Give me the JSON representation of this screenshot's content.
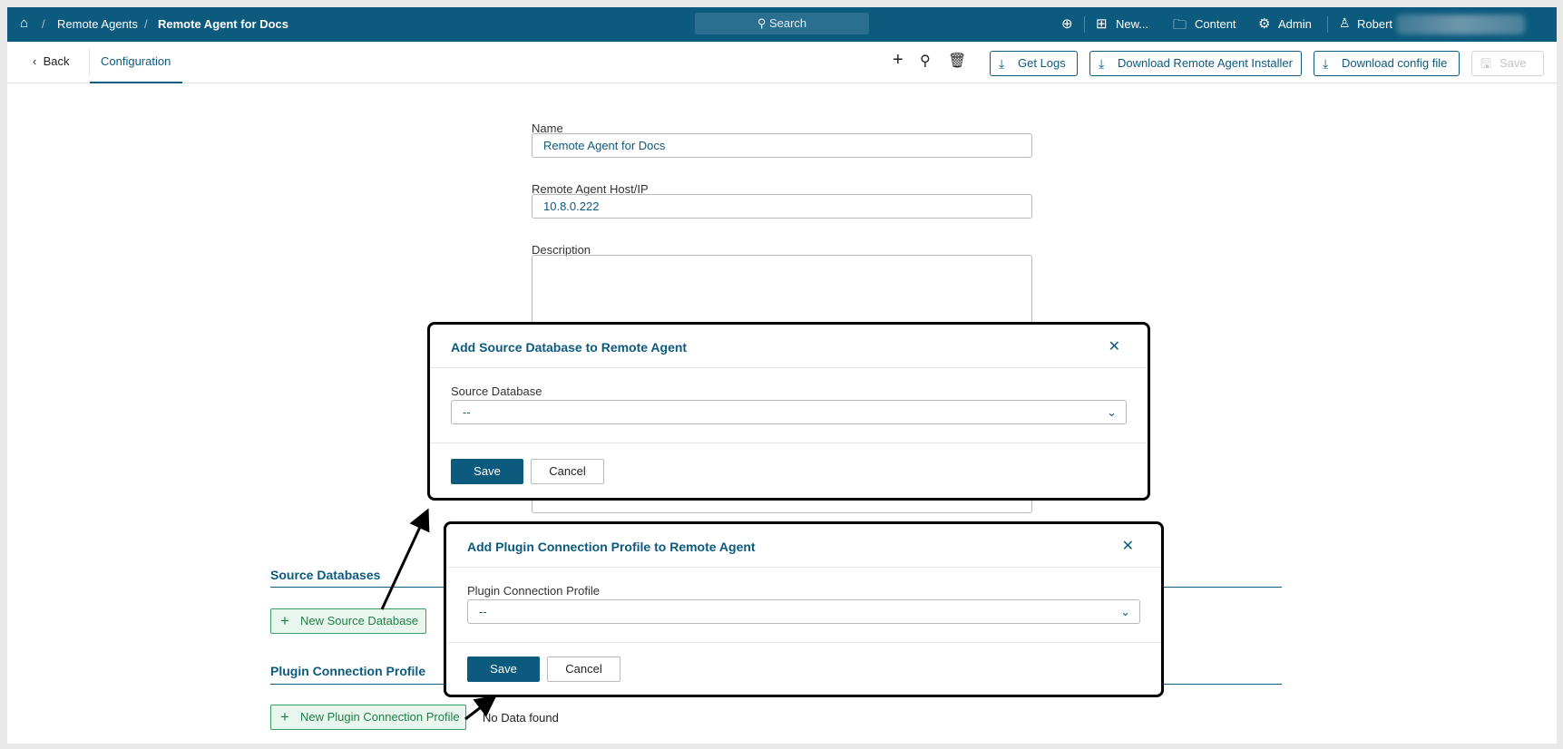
{
  "topbar": {
    "breadcrumb": [
      "Remote Agents",
      "Remote Agent for Docs"
    ],
    "search": "Search",
    "new": "New...",
    "content": "Content",
    "admin": "Admin",
    "user": "Robert"
  },
  "subbar": {
    "back": "Back",
    "tab": "Configuration",
    "get_logs": "Get Logs",
    "download_installer": "Download Remote Agent Installer",
    "download_config": "Download config file",
    "save": "Save"
  },
  "form": {
    "name_label": "Name",
    "name_value": "Remote Agent for Docs",
    "host_label": "Remote Agent Host/IP",
    "host_value": "10.8.0.222",
    "description_label": "Description"
  },
  "sections": {
    "source_db_title": "Source Databases",
    "new_source_db": "New Source Database",
    "plugin_title": "Plugin Connection Profile",
    "new_plugin": "New Plugin Connection Profile",
    "no_data": "No Data found"
  },
  "dialog1": {
    "title": "Add Source Database to Remote Agent",
    "field_label": "Source Database",
    "value": "--",
    "save": "Save",
    "cancel": "Cancel"
  },
  "dialog2": {
    "title": "Add Plugin Connection Profile to Remote Agent",
    "field_label": "Plugin Connection Profile",
    "value": "--",
    "save": "Save",
    "cancel": "Cancel"
  }
}
